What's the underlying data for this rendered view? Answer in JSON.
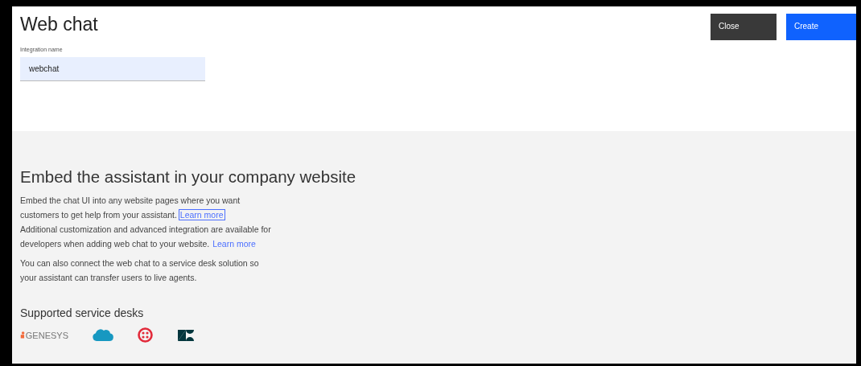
{
  "header": {
    "title": "Web chat",
    "buttons": [
      {
        "label": "Close",
        "kind": "secondary"
      },
      {
        "label": "Create",
        "kind": "primary"
      }
    ]
  },
  "name_field": {
    "label": "Integration name",
    "value": "webchat"
  },
  "embed": {
    "heading": "Embed the assistant in your company website",
    "paragraphs": [
      {
        "text": "Embed the chat UI into any website pages where you want customers to get help from your assistant.",
        "link": {
          "label": "Learn more",
          "focused": true
        }
      },
      {
        "text": "Additional customization and advanced integration are available for developers when adding web chat to your website.",
        "link": {
          "label": "Learn more",
          "focused": false
        }
      },
      {
        "text": "You can also connect the web chat to a service desk solution so your assistant can transfer users to live agents."
      }
    ],
    "desks_heading": "Supported service desks",
    "desks": [
      {
        "kind": "genesys",
        "label": "GENESYS"
      },
      {
        "kind": "cloud"
      },
      {
        "kind": "ring"
      },
      {
        "kind": "z"
      }
    ]
  }
}
